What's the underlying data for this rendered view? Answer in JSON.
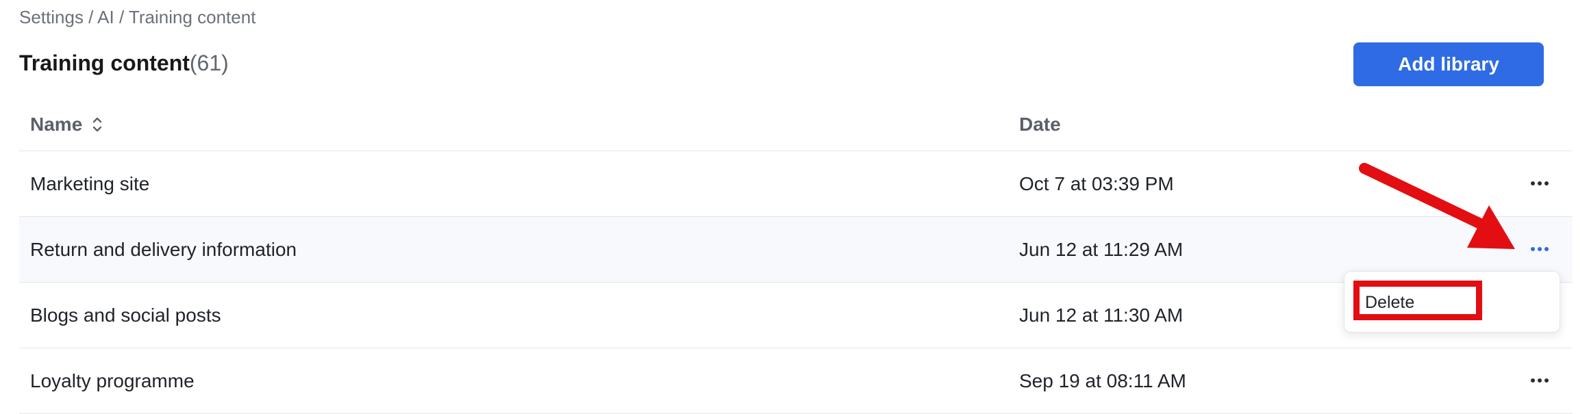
{
  "breadcrumb": "Settings / AI / Training content",
  "header": {
    "title": "Training content",
    "count": "(61)",
    "add_button_label": "Add library"
  },
  "table": {
    "columns": {
      "name": "Name",
      "date": "Date"
    },
    "rows": [
      {
        "name": "Marketing site",
        "date": "Oct 7 at 03:39 PM"
      },
      {
        "name": "Return and delivery information",
        "date": "Jun 12 at 11:29 AM"
      },
      {
        "name": "Blogs and social posts",
        "date": "Jun 12 at 11:30 AM"
      },
      {
        "name": "Loyalty programme",
        "date": "Sep 19 at 08:11 AM"
      }
    ]
  },
  "context_menu": {
    "items": [
      "Delete"
    ]
  },
  "colors": {
    "accent": "#2f6be4",
    "annotation": "#e20e12"
  },
  "icons": {
    "sort": "sort-updown-icon",
    "more": "more-horizontal-icon"
  }
}
